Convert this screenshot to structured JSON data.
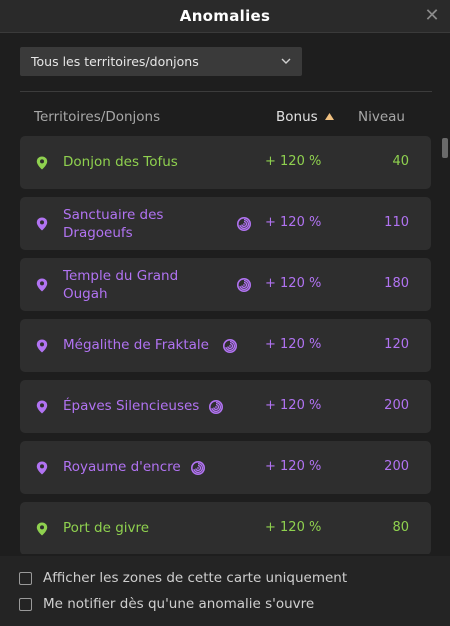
{
  "window": {
    "title": "Anomalies",
    "close_icon": "close-icon"
  },
  "filter": {
    "selected": "Tous les territoires/donjons",
    "icon": "chevron-down-icon"
  },
  "table": {
    "headers": {
      "territory": "Territoires/Donjons",
      "bonus": "Bonus",
      "level": "Niveau"
    },
    "sort_column": "Bonus",
    "sort_direction": "ascending",
    "rows": [
      {
        "name_lines": [
          "Donjon des Tofus"
        ],
        "bonus": "+ 120 %",
        "level": "40",
        "anomaly_icon": false,
        "color": "#8fd14f"
      },
      {
        "name_lines": [
          "Sanctuaire des",
          "Dragoeufs"
        ],
        "bonus": "+ 120 %",
        "level": "110",
        "anomaly_icon": true,
        "color": "#b173f2"
      },
      {
        "name_lines": [
          "Temple du Grand",
          "Ougah"
        ],
        "bonus": "+ 120 %",
        "level": "180",
        "anomaly_icon": true,
        "color": "#b173f2"
      },
      {
        "name_lines": [
          "Mégalithe de Fraktale"
        ],
        "bonus": "+ 120 %",
        "level": "120",
        "anomaly_icon": true,
        "color": "#b173f2"
      },
      {
        "name_lines": [
          "Épaves Silencieuses"
        ],
        "bonus": "+ 120 %",
        "level": "200",
        "anomaly_icon": true,
        "color": "#b173f2"
      },
      {
        "name_lines": [
          "Royaume d'encre"
        ],
        "bonus": "+ 120 %",
        "level": "200",
        "anomaly_icon": true,
        "color": "#b173f2"
      },
      {
        "name_lines": [
          "Port de givre"
        ],
        "bonus": "+ 120 %",
        "level": "80",
        "anomaly_icon": false,
        "color": "#8fd14f"
      }
    ]
  },
  "options": [
    {
      "label": "Afficher les zones de cette carte uniquement",
      "checked": false
    },
    {
      "label": "Me notifier dès qu'une anomalie s'ouvre",
      "checked": false
    }
  ],
  "colors": {
    "green": "#8fd14f",
    "purple": "#b173f2",
    "sort_arrow": "#f0c080"
  }
}
